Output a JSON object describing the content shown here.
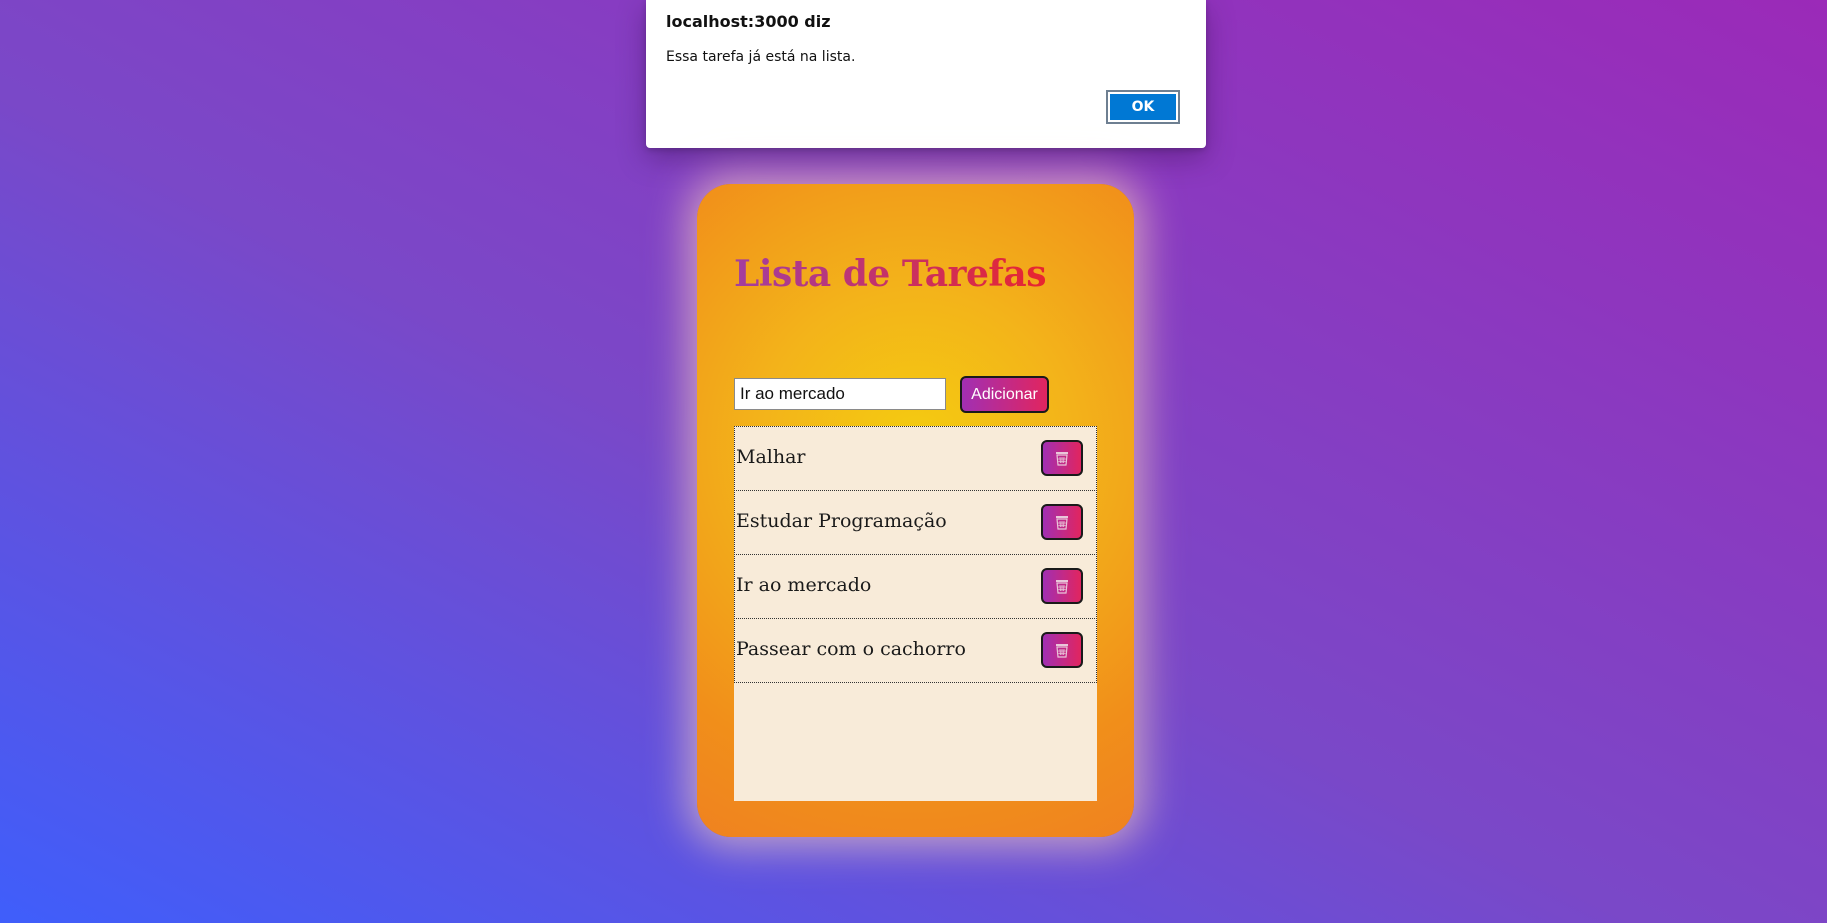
{
  "alert": {
    "title": "localhost:3000 diz",
    "message": "Essa tarefa já está na lista.",
    "ok_label": "OK"
  },
  "app": {
    "title": "Lista de Tarefas",
    "input_value": "Ir ao mercado",
    "add_label": "Adicionar",
    "tasks": [
      {
        "text": "Malhar",
        "delete_icon": "trash-icon"
      },
      {
        "text": "Estudar Programação",
        "delete_icon": "trash-icon"
      },
      {
        "text": "Ir ao mercado",
        "delete_icon": "trash-icon"
      },
      {
        "text": "Passear com o cachorro",
        "delete_icon": "trash-icon"
      }
    ]
  },
  "colors": {
    "background_start": "#3f5efb",
    "background_end": "#9b2ab8",
    "card_center": "#f4cc10",
    "card_edge": "#ef8220",
    "button_gradient_start": "#a12fb3",
    "button_gradient_end": "#e1255f",
    "list_background": "#f8ebd9",
    "alert_ok": "#0078d4"
  }
}
